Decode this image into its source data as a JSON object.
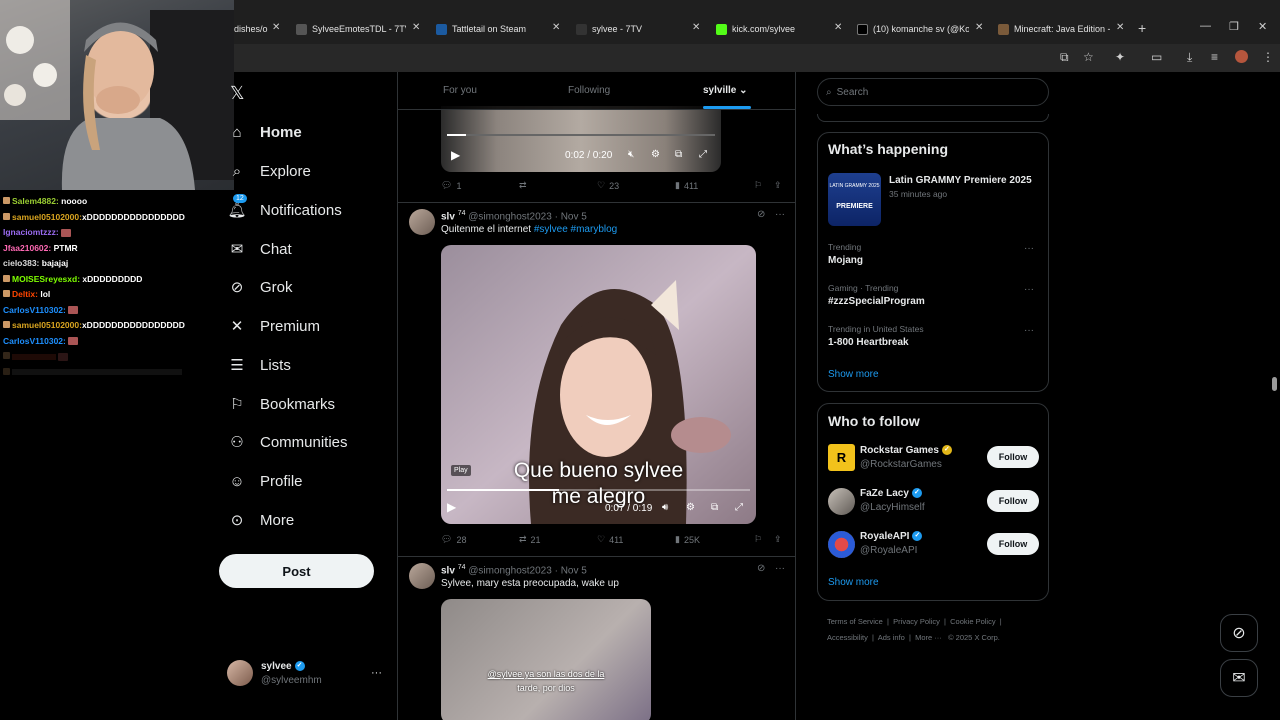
{
  "browser": {
    "tabs": [
      {
        "label": "dishes/o"
      },
      {
        "label": "SylveeEmotesTDL - 7TV"
      },
      {
        "label": "Tattletail on Steam"
      },
      {
        "label": "sylvee - 7TV"
      },
      {
        "label": "kick.com/sylvee"
      },
      {
        "label": "(10) komanche sv (@Koma"
      },
      {
        "label": "Minecraft: Java Edition - S"
      }
    ],
    "new_tab": "+"
  },
  "chat": [
    {
      "user": "Salem4882:",
      "msg": "noooo",
      "color": "#9acd32"
    },
    {
      "user": "samuel05102000:",
      "msg": "xDDDDDDDDDDDDDDDD",
      "color": "#daa520"
    },
    {
      "user": "Ignaciomtzzz:",
      "msg": "",
      "color": "#8a2be2",
      "emote": true
    },
    {
      "user": "Jfaa210602:",
      "msg": "PTMR",
      "color": "#ff69b4"
    },
    {
      "user": "cielo383:",
      "msg": "bajajaj",
      "color": "#dcdcdc"
    },
    {
      "user": "MOISESreyesxd:",
      "msg": "xDDDDDDDDD",
      "color": "#7fff00"
    },
    {
      "user": "Deltix:",
      "msg": "lol",
      "color": "#ff4500"
    },
    {
      "user": "CarlosV110302:",
      "msg": "",
      "color": "#1e90ff",
      "emote": true
    },
    {
      "user": "samuel05102000:",
      "msg": "xDDDDDDDDDDDDDDDD",
      "color": "#daa520"
    },
    {
      "user": "CarlosV110302:",
      "msg": "",
      "color": "#1e90ff",
      "emote": true
    }
  ],
  "nav": {
    "home": "Home",
    "explore": "Explore",
    "notifications": "Notifications",
    "notif_count": "12",
    "chat": "Chat",
    "grok": "Grok",
    "premium": "Premium",
    "lists": "Lists",
    "bookmarks": "Bookmarks",
    "communities": "Communities",
    "profile": "Profile",
    "more": "More",
    "post": "Post"
  },
  "account": {
    "name": "sylvee",
    "handle": "@sylveemhm"
  },
  "timeline_tabs": {
    "for_you": "For you",
    "following": "Following",
    "custom": "sylville"
  },
  "tweets": [
    {
      "video_time": "0:02 / 0:20",
      "replies": "1",
      "reposts": "",
      "likes": "23",
      "views": "411"
    },
    {
      "name": "slv",
      "sup": "74",
      "handle": "@simonghost2023",
      "date": "· Nov 5",
      "text": "Quitenme el internet",
      "tags": [
        "#sylvee",
        "#maryblog"
      ],
      "caption_1": "Que bueno sylvee",
      "caption_2": "me alegro",
      "play_tooltip": "Play",
      "video_time": "0:07 / 0:19",
      "replies": "28",
      "reposts": "21",
      "likes": "411",
      "views": "25K"
    },
    {
      "name": "slv",
      "sup": "74",
      "handle": "@simonghost2023",
      "date": "· Nov 5",
      "text": "Sylvee, mary esta preocupada, wake up",
      "caption_1": "@sylvee ya son las dos de la",
      "caption_2": "tarde, por dios"
    }
  ],
  "search": {
    "placeholder": "Search"
  },
  "whats_happening": {
    "title": "What’s happening",
    "featured": {
      "title": "Latin GRAMMY Premiere 2025",
      "time": "35 minutes ago",
      "thumb_line1": "LATIN GRAMMY 2025",
      "thumb_line2": "PREMIERE"
    },
    "trends": [
      {
        "meta": "Trending",
        "name": "Mojang"
      },
      {
        "meta": "Gaming · Trending",
        "name": "#zzzSpecialProgram"
      },
      {
        "meta": "Trending in United States",
        "name": "1-800 Heartbreak"
      }
    ],
    "show_more": "Show more"
  },
  "who_to_follow": {
    "title": "Who to follow",
    "accounts": [
      {
        "name": "Rockstar Games",
        "handle": "@RockstarGames",
        "follow": "Follow"
      },
      {
        "name": "FaZe Lacy",
        "handle": "@LacyHimself",
        "follow": "Follow"
      },
      {
        "name": "RoyaleAPI",
        "handle": "@RoyaleAPI",
        "follow": "Follow"
      }
    ],
    "show_more": "Show more"
  },
  "footer": {
    "tos": "Terms of Service",
    "privacy": "Privacy Policy",
    "cookie": "Cookie Policy",
    "accessibility": "Accessibility",
    "ads": "Ads info",
    "more": "More ···",
    "copyright": "© 2025 X Corp."
  },
  "colors": {
    "accent": "#1d9bf0",
    "verified_gold": "#e2b719",
    "background": "#000000"
  }
}
